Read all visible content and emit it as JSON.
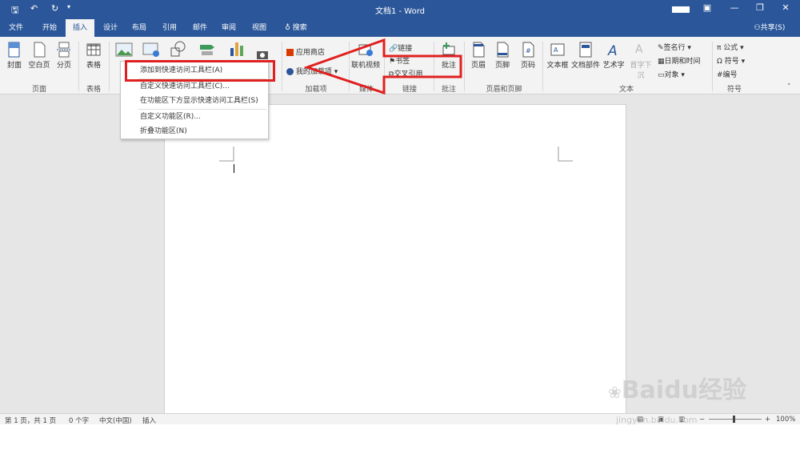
{
  "window": {
    "title": "文档1 - Word"
  },
  "tabs": [
    "文件",
    "开始",
    "插入",
    "设计",
    "布局",
    "引用",
    "邮件",
    "审阅",
    "视图"
  ],
  "tell_me": "搜索",
  "share": "共享(S)",
  "ribbon": {
    "cover": "封面",
    "blank": "空白页",
    "pagebreak": "分页",
    "table": "表格",
    "store": "应用商店",
    "myaddins": "我的加载项",
    "online_video": "联机视频",
    "link": "链接",
    "bookmark": "书签",
    "crossref": "交叉引用",
    "comment": "批注",
    "header": "页眉",
    "footer": "页脚",
    "pagenum": "页码",
    "textbox": "文本框",
    "docparts": "文档部件",
    "wordart": "艺术字",
    "dropcap": "首字下沉",
    "signature": "签名行",
    "datetime": "日期和时间",
    "object": "对象",
    "equation": "公式",
    "symbol": "符号",
    "number": "编号",
    "groups": {
      "pages": "页面",
      "tables": "表格",
      "addins": "加载项",
      "media": "媒体",
      "links": "链接",
      "comments": "批注",
      "headerfooter": "页眉和页脚",
      "text": "文本",
      "symbols": "符号"
    }
  },
  "context_menu": [
    "添加到快速访问工具栏(A)",
    "自定义快速访问工具栏(C)...",
    "在功能区下方显示快速访问工具栏(S)",
    "自定义功能区(R)...",
    "折叠功能区(N)"
  ],
  "status": {
    "page": "第 1 页，共 1 页",
    "words": "0 个字",
    "lang": "中文(中国)",
    "mode": "插入",
    "zoom": "100%"
  },
  "watermark": {
    "brand": "Baidu经验",
    "url": "jingyan.baidu.com"
  },
  "colors": {
    "accent": "#2b579a",
    "highlight": "#e02020"
  }
}
